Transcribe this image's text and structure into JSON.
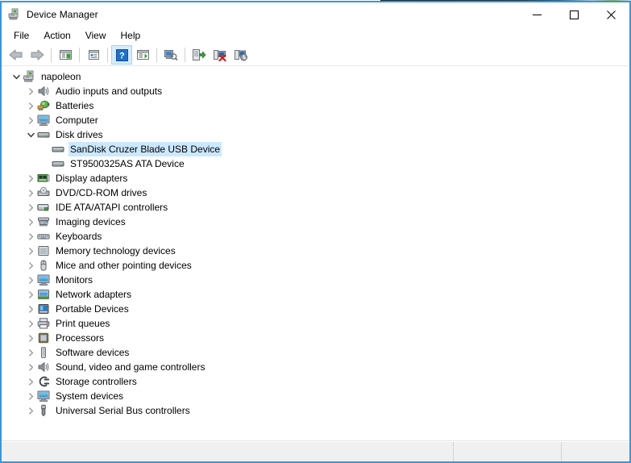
{
  "window": {
    "title": "Device Manager",
    "icon": "device-manager-icon",
    "minimize_label": "Minimize",
    "maximize_label": "Maximize",
    "close_label": "Close",
    "frame_color": "#3a96dd"
  },
  "menu": {
    "items": [
      {
        "label": "File",
        "name": "menu-file"
      },
      {
        "label": "Action",
        "name": "menu-action"
      },
      {
        "label": "View",
        "name": "menu-view"
      },
      {
        "label": "Help",
        "name": "menu-help"
      }
    ]
  },
  "toolbar": {
    "buttons": [
      {
        "name": "back-button",
        "icon": "back-arrow-icon",
        "enabled": false,
        "tooltip": "Back"
      },
      {
        "name": "forward-button",
        "icon": "forward-arrow-icon",
        "enabled": false,
        "tooltip": "Forward"
      },
      {
        "name": "show-hide-console-tree-button",
        "icon": "console-tree-icon",
        "enabled": true,
        "tooltip": "Show/Hide Console Tree"
      },
      {
        "name": "properties-button",
        "icon": "properties-icon",
        "enabled": true,
        "tooltip": "Properties"
      },
      {
        "name": "help-button",
        "icon": "help-question-icon",
        "enabled": true,
        "tooltip": "Help"
      },
      {
        "name": "show-hide-action-pane-button",
        "icon": "action-pane-icon",
        "enabled": true,
        "tooltip": "Show/Hide Action Pane"
      },
      {
        "name": "scan-for-hardware-changes-button",
        "icon": "scan-hardware-icon",
        "enabled": true,
        "tooltip": "Scan for hardware changes"
      },
      {
        "name": "update-driver-button",
        "icon": "update-driver-icon",
        "enabled": true,
        "tooltip": "Update driver"
      },
      {
        "name": "uninstall-device-button",
        "icon": "uninstall-device-icon",
        "enabled": true,
        "tooltip": "Uninstall device"
      },
      {
        "name": "disable-device-button",
        "icon": "disable-device-icon",
        "enabled": true,
        "tooltip": "Disable device"
      }
    ]
  },
  "tree": {
    "nodes": [
      {
        "label": "napoleon",
        "depth": 0,
        "state": "expanded",
        "icon": "computer-root-icon",
        "selected": false
      },
      {
        "label": "Audio inputs and outputs",
        "depth": 1,
        "state": "collapsed",
        "icon": "speaker-icon",
        "selected": false
      },
      {
        "label": "Batteries",
        "depth": 1,
        "state": "collapsed",
        "icon": "battery-icon",
        "selected": false
      },
      {
        "label": "Computer",
        "depth": 1,
        "state": "collapsed",
        "icon": "monitor-icon",
        "selected": false
      },
      {
        "label": "Disk drives",
        "depth": 1,
        "state": "expanded",
        "icon": "disk-drive-icon",
        "selected": false
      },
      {
        "label": "SanDisk Cruzer Blade USB Device",
        "depth": 2,
        "state": "leaf",
        "icon": "disk-drive-icon",
        "selected": true
      },
      {
        "label": "ST9500325AS ATA Device",
        "depth": 2,
        "state": "leaf",
        "icon": "disk-drive-icon",
        "selected": false
      },
      {
        "label": "Display adapters",
        "depth": 1,
        "state": "collapsed",
        "icon": "display-adapter-icon",
        "selected": false
      },
      {
        "label": "DVD/CD-ROM drives",
        "depth": 1,
        "state": "collapsed",
        "icon": "dvd-drive-icon",
        "selected": false
      },
      {
        "label": "IDE ATA/ATAPI controllers",
        "depth": 1,
        "state": "collapsed",
        "icon": "ide-controller-icon",
        "selected": false
      },
      {
        "label": "Imaging devices",
        "depth": 1,
        "state": "collapsed",
        "icon": "imaging-device-icon",
        "selected": false
      },
      {
        "label": "Keyboards",
        "depth": 1,
        "state": "collapsed",
        "icon": "keyboard-icon",
        "selected": false
      },
      {
        "label": "Memory technology devices",
        "depth": 1,
        "state": "collapsed",
        "icon": "memory-device-icon",
        "selected": false
      },
      {
        "label": "Mice and other pointing devices",
        "depth": 1,
        "state": "collapsed",
        "icon": "mouse-icon",
        "selected": false
      },
      {
        "label": "Monitors",
        "depth": 1,
        "state": "collapsed",
        "icon": "monitor-icon",
        "selected": false
      },
      {
        "label": "Network adapters",
        "depth": 1,
        "state": "collapsed",
        "icon": "network-adapter-icon",
        "selected": false
      },
      {
        "label": "Portable Devices",
        "depth": 1,
        "state": "collapsed",
        "icon": "portable-device-icon",
        "selected": false
      },
      {
        "label": "Print queues",
        "depth": 1,
        "state": "collapsed",
        "icon": "printer-icon",
        "selected": false
      },
      {
        "label": "Processors",
        "depth": 1,
        "state": "collapsed",
        "icon": "processor-icon",
        "selected": false
      },
      {
        "label": "Software devices",
        "depth": 1,
        "state": "collapsed",
        "icon": "software-device-icon",
        "selected": false
      },
      {
        "label": "Sound, video and game controllers",
        "depth": 1,
        "state": "collapsed",
        "icon": "speaker-icon",
        "selected": false
      },
      {
        "label": "Storage controllers",
        "depth": 1,
        "state": "collapsed",
        "icon": "storage-controller-icon",
        "selected": false
      },
      {
        "label": "System devices",
        "depth": 1,
        "state": "collapsed",
        "icon": "monitor-icon",
        "selected": false
      },
      {
        "label": "Universal Serial Bus controllers",
        "depth": 1,
        "state": "collapsed",
        "icon": "usb-icon",
        "selected": false
      }
    ]
  },
  "statusbar": {
    "cells": [
      "",
      "",
      ""
    ]
  }
}
